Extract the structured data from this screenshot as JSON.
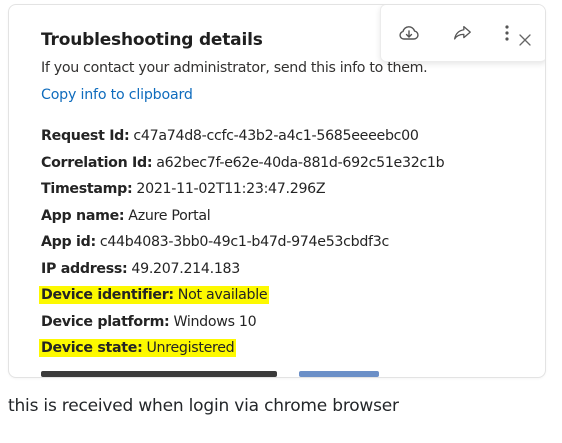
{
  "panel": {
    "title": "Troubleshooting details",
    "subtitle": "If you contact your administrator, send this info to them.",
    "copy_link": "Copy info to clipboard",
    "toolbar": {
      "icons": [
        "download-icon",
        "share-icon",
        "more-options-icon"
      ]
    },
    "close_icon": "close-icon",
    "details": [
      {
        "label": "Request Id:",
        "value": "c47a74d8-ccfc-43b2-a4c1-5685eeeebc00",
        "highlight": false
      },
      {
        "label": "Correlation Id:",
        "value": "a62bec7f-e62e-40da-881d-692c51e32c1b",
        "highlight": false
      },
      {
        "label": "Timestamp:",
        "value": "2021-11-02T11:23:47.296Z",
        "highlight": false
      },
      {
        "label": "App name:",
        "value": "Azure Portal",
        "highlight": false
      },
      {
        "label": "App id:",
        "value": "c44b4083-3bb0-49c1-b47d-974e53cbdf3c",
        "highlight": false
      },
      {
        "label": "IP address:",
        "value": "49.207.214.183",
        "highlight": false
      },
      {
        "label": "Device identifier:",
        "value": "Not available",
        "highlight": true
      },
      {
        "label": "Device platform:",
        "value": "Windows 10",
        "highlight": false
      },
      {
        "label": "Device state:",
        "value": "Unregistered",
        "highlight": true
      }
    ]
  },
  "caption": "this is received when login via chrome browser",
  "colors": {
    "highlight": "#fdf900",
    "link": "#0f6cbd"
  }
}
